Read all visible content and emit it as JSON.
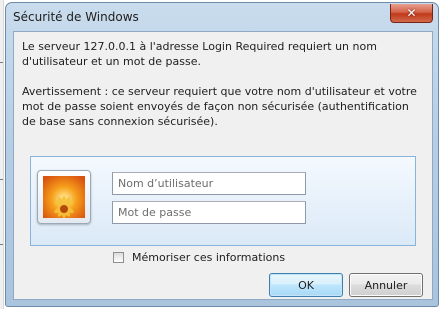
{
  "window": {
    "title": "Sécurité de Windows",
    "close_glyph": "✕"
  },
  "message": {
    "line1": "Le serveur 127.0.0.1 à l'adresse Login Required requiert un nom d'utilisateur et un mot de passe.",
    "warning": "Avertissement : ce serveur requiert que votre nom d'utilisateur et votre mot de passe soient envoyés de façon non sécurisée (authentification de base sans connexion sécurisée)."
  },
  "credentials": {
    "user_tile_icon": "flower-user-picture",
    "username_placeholder": "Nom d’utilisateur",
    "username_value": "",
    "password_placeholder": "Mot de passe",
    "password_value": "",
    "remember_label": "Mémoriser ces informations",
    "remember_checked": false
  },
  "buttons": {
    "ok_label": "OK",
    "cancel_label": "Annuler"
  },
  "colors": {
    "ok_border": "#3c7fb1",
    "close_red": "#c1391a",
    "panel_border": "#87b3dd"
  }
}
